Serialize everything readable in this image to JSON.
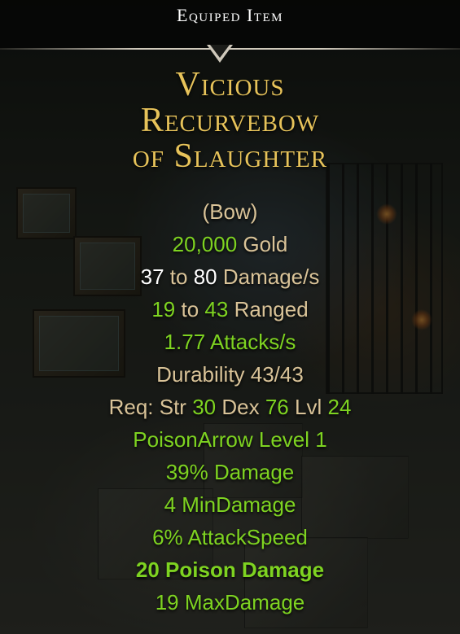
{
  "header": {
    "title": "Equiped Item"
  },
  "item": {
    "name_lines": [
      "Vicious",
      "Recurvebow",
      "of Slaughter"
    ],
    "type": "(Bow)",
    "value": {
      "amount": "20,000",
      "unit": "Gold"
    },
    "damage": {
      "min": "37",
      "to": "to",
      "max": "80",
      "unit": "Damage/s"
    },
    "ranged": {
      "min": "19",
      "to": "to",
      "max": "43",
      "unit": "Ranged"
    },
    "attack_speed": {
      "value": "1.77",
      "unit": "Attacks/s"
    },
    "durability": "Durability 43/43",
    "requirements": {
      "prefix": "Req:",
      "str_label": "Str",
      "str": "30",
      "dex_label": "Dex",
      "dex": "76",
      "lvl_label": "Lvl",
      "lvl": "24"
    },
    "affixes": [
      "PoisonArrow Level 1",
      "39% Damage",
      "4 MinDamage",
      "6% AttackSpeed",
      "20 Poison Damage",
      "19 MaxDamage"
    ]
  },
  "colors": {
    "name": "#e7c35a",
    "label": "#d9c398",
    "bonus": "#7ed321",
    "value": "#ffffff"
  }
}
